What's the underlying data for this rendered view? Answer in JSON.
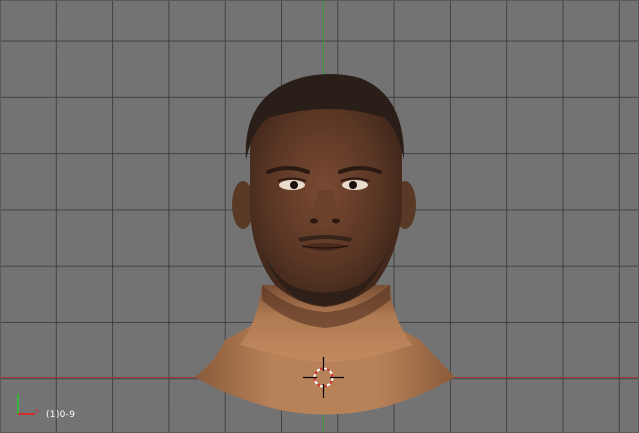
{
  "viewport": {
    "view": "front-orthographic",
    "grid": true,
    "background_color": "#737373",
    "grid_line_color": "#3a3a3a",
    "axis_x_color": "#a43a3a",
    "axis_y_color": "#3a9a3a",
    "frame_label": "(1)0-9",
    "frame_label_color": "#ffffff"
  },
  "model": {
    "object": "head-mesh",
    "skin_color": "#a46a44",
    "hair_color": "#2a1e18"
  },
  "icons": {
    "cursor": "3d-cursor-icon",
    "orientation": "axis-orientation-icon"
  }
}
